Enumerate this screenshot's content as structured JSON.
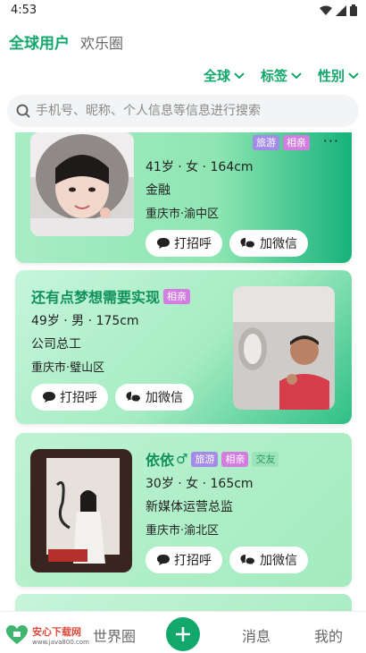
{
  "status_bar": {
    "time": "4:53"
  },
  "top_tabs": {
    "active": "全球用户",
    "inactive": "欢乐圈"
  },
  "filters": [
    {
      "label": "全球"
    },
    {
      "label": "标签"
    },
    {
      "label": "性别"
    }
  ],
  "search": {
    "placeholder": "手机号、昵称、个人信息等信息进行搜索"
  },
  "cards": [
    {
      "name": "",
      "tags": [
        "旅游",
        "相亲"
      ],
      "age_gender_height": "41岁 · 女 · 164cm",
      "occupation": "金融",
      "location": "重庆市·渝中区",
      "greet_label": "打招呼",
      "wechat_label": "加微信"
    },
    {
      "name": "还有点梦想需要实现",
      "tags": [
        "相亲"
      ],
      "age_gender_height": "49岁 · 男 · 175cm",
      "occupation": "公司总工",
      "location": "重庆市·璧山区",
      "greet_label": "打招呼",
      "wechat_label": "加微信"
    },
    {
      "name": "依依",
      "gender_symbol": "♂",
      "tags": [
        "旅游",
        "相亲",
        "交友"
      ],
      "age_gender_height": "30岁 · 女 · 165cm",
      "occupation": "新媒体运营总监",
      "location": "重庆市·渝北区",
      "greet_label": "打招呼",
      "wechat_label": "加微信"
    }
  ],
  "bottom_nav": {
    "world_circle": "世界圈",
    "messages": "消息",
    "mine": "我的"
  },
  "watermark": {
    "title": "安心下载网",
    "url": "www.java800.com"
  },
  "colors": {
    "accent": "#13a86b",
    "tag_travel": "#a48be8",
    "tag_date": "#d37de0"
  }
}
